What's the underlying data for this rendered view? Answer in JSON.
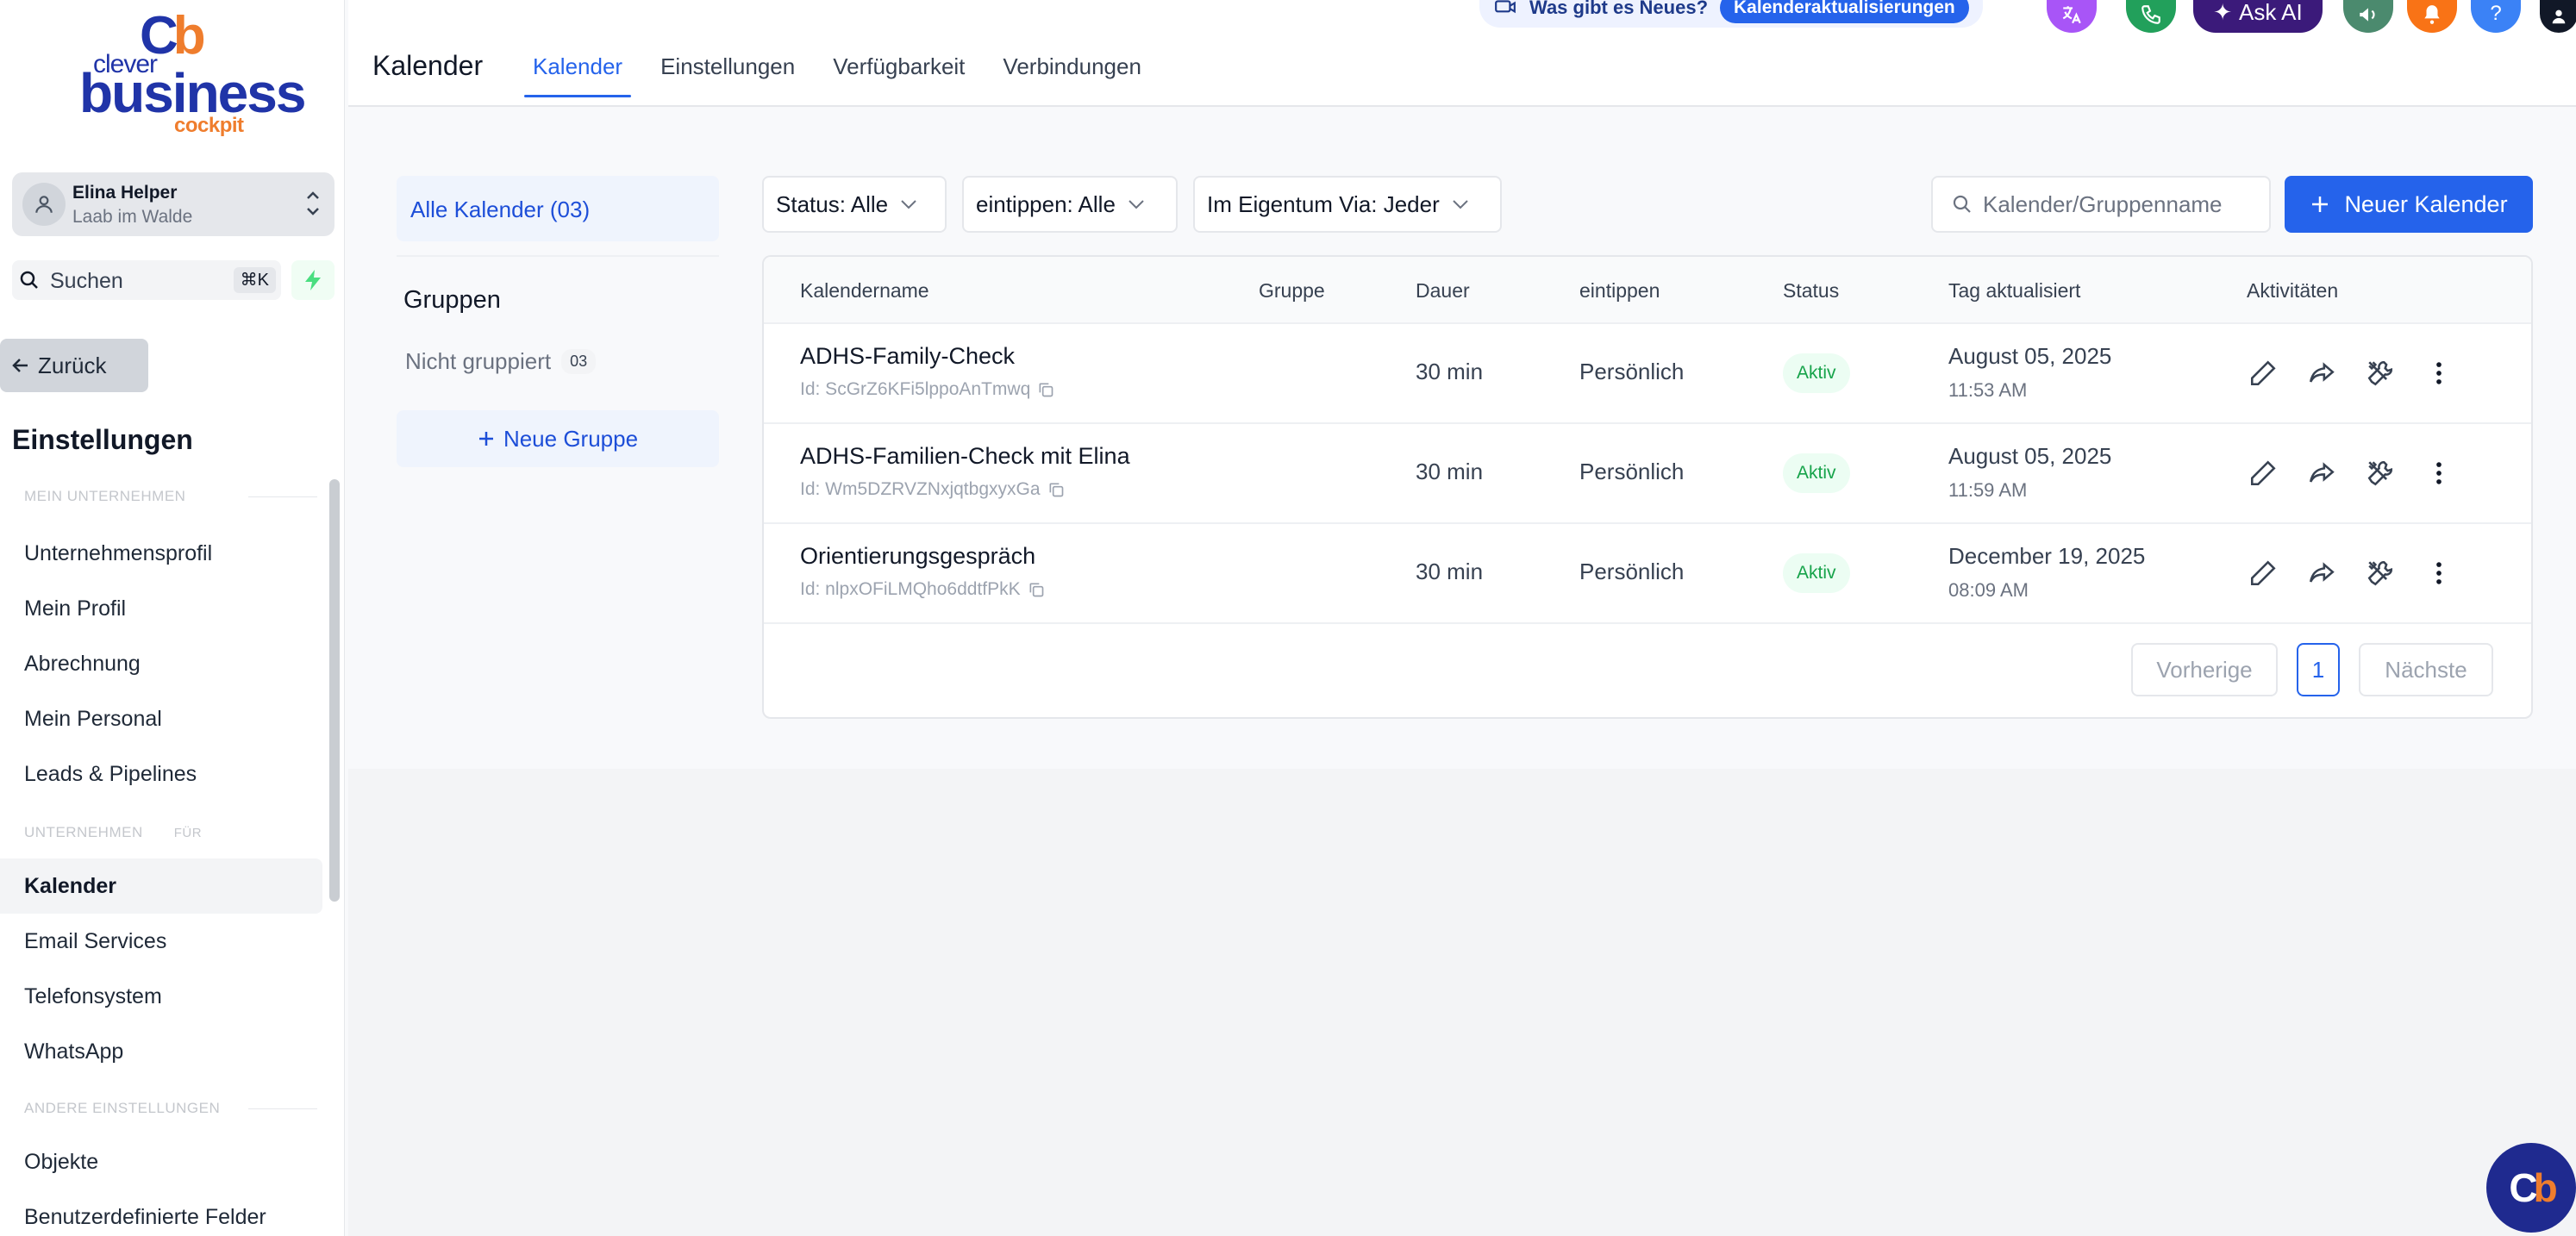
{
  "brand": {
    "mark_c": "C",
    "mark_b": "b",
    "clever": "clever",
    "business": "business",
    "cockpit": "cockpit"
  },
  "account": {
    "name": "Elina Helper",
    "location": "Laab im Walde"
  },
  "sidebar_search": {
    "label": "Suchen",
    "shortcut": "⌘K"
  },
  "back_label": "Zurück",
  "settings_title": "Einstellungen",
  "nav": {
    "section1": "MEIN UNTERNEHMEN",
    "items1": [
      "Unternehmensprofil",
      "Mein Profil",
      "Abrechnung",
      "Mein Personal",
      "Leads & Pipelines"
    ],
    "section2": "UNTERNEHMEN",
    "section2_suffix": "FÜR",
    "items2": [
      "Kalender",
      "Email Services",
      "Telefonsystem",
      "WhatsApp"
    ],
    "section3": "ANDERE EINSTELLUNGEN",
    "items3": [
      "Objekte",
      "Benutzerdefinierte Felder"
    ]
  },
  "topbar": {
    "title": "Kalender",
    "tabs": [
      "Kalender",
      "Einstellungen",
      "Verfügbarkeit",
      "Verbindungen"
    ],
    "news_text": "Was gibt es Neues?",
    "news_pill": "Kalenderaktualisierungen",
    "ask_ai": "Ask AI",
    "help": "?"
  },
  "groups": {
    "all": "Alle Kalender (03)",
    "heading": "Gruppen",
    "ungrouped": "Nicht gruppiert",
    "ungrouped_count": "03",
    "new_group": "Neue Gruppe"
  },
  "filters": {
    "status": "Status: Alle",
    "type": "eintippen: Alle",
    "owner": "Im Eigentum Via: Jeder",
    "search_placeholder": "Kalender/Gruppenname",
    "new_calendar": "Neuer Kalender"
  },
  "table": {
    "headers": [
      "Kalendername",
      "Gruppe",
      "Dauer",
      "eintippen",
      "Status",
      "Tag aktualisiert",
      "Aktivitäten"
    ],
    "rows": [
      {
        "name": "ADHS-Family-Check",
        "id": "Id: ScGrZ6KFi5lppoAnTmwq",
        "group": "",
        "duration": "30 min",
        "type": "Persönlich",
        "status": "Aktiv",
        "date": "August 05, 2025",
        "time": "11:53 AM"
      },
      {
        "name": "ADHS-Familien-Check mit Elina",
        "id": "Id: Wm5DZRVZNxjqtbgxyxGa",
        "group": "",
        "duration": "30 min",
        "type": "Persönlich",
        "status": "Aktiv",
        "date": "August 05, 2025",
        "time": "11:59 AM"
      },
      {
        "name": "Orientierungsgespräch",
        "id": "Id: nlpxOFiLMQho6ddtfPkK",
        "group": "",
        "duration": "30 min",
        "type": "Persönlich",
        "status": "Aktiv",
        "date": "December 19, 2025",
        "time": "08:09 AM"
      }
    ]
  },
  "pagination": {
    "prev": "Vorherige",
    "page": "1",
    "next": "Nächste"
  },
  "colors": {
    "primary": "#2563eb",
    "brand_blue": "#2034a8",
    "brand_orange": "#ef7d2d",
    "success": "#16a34a"
  }
}
